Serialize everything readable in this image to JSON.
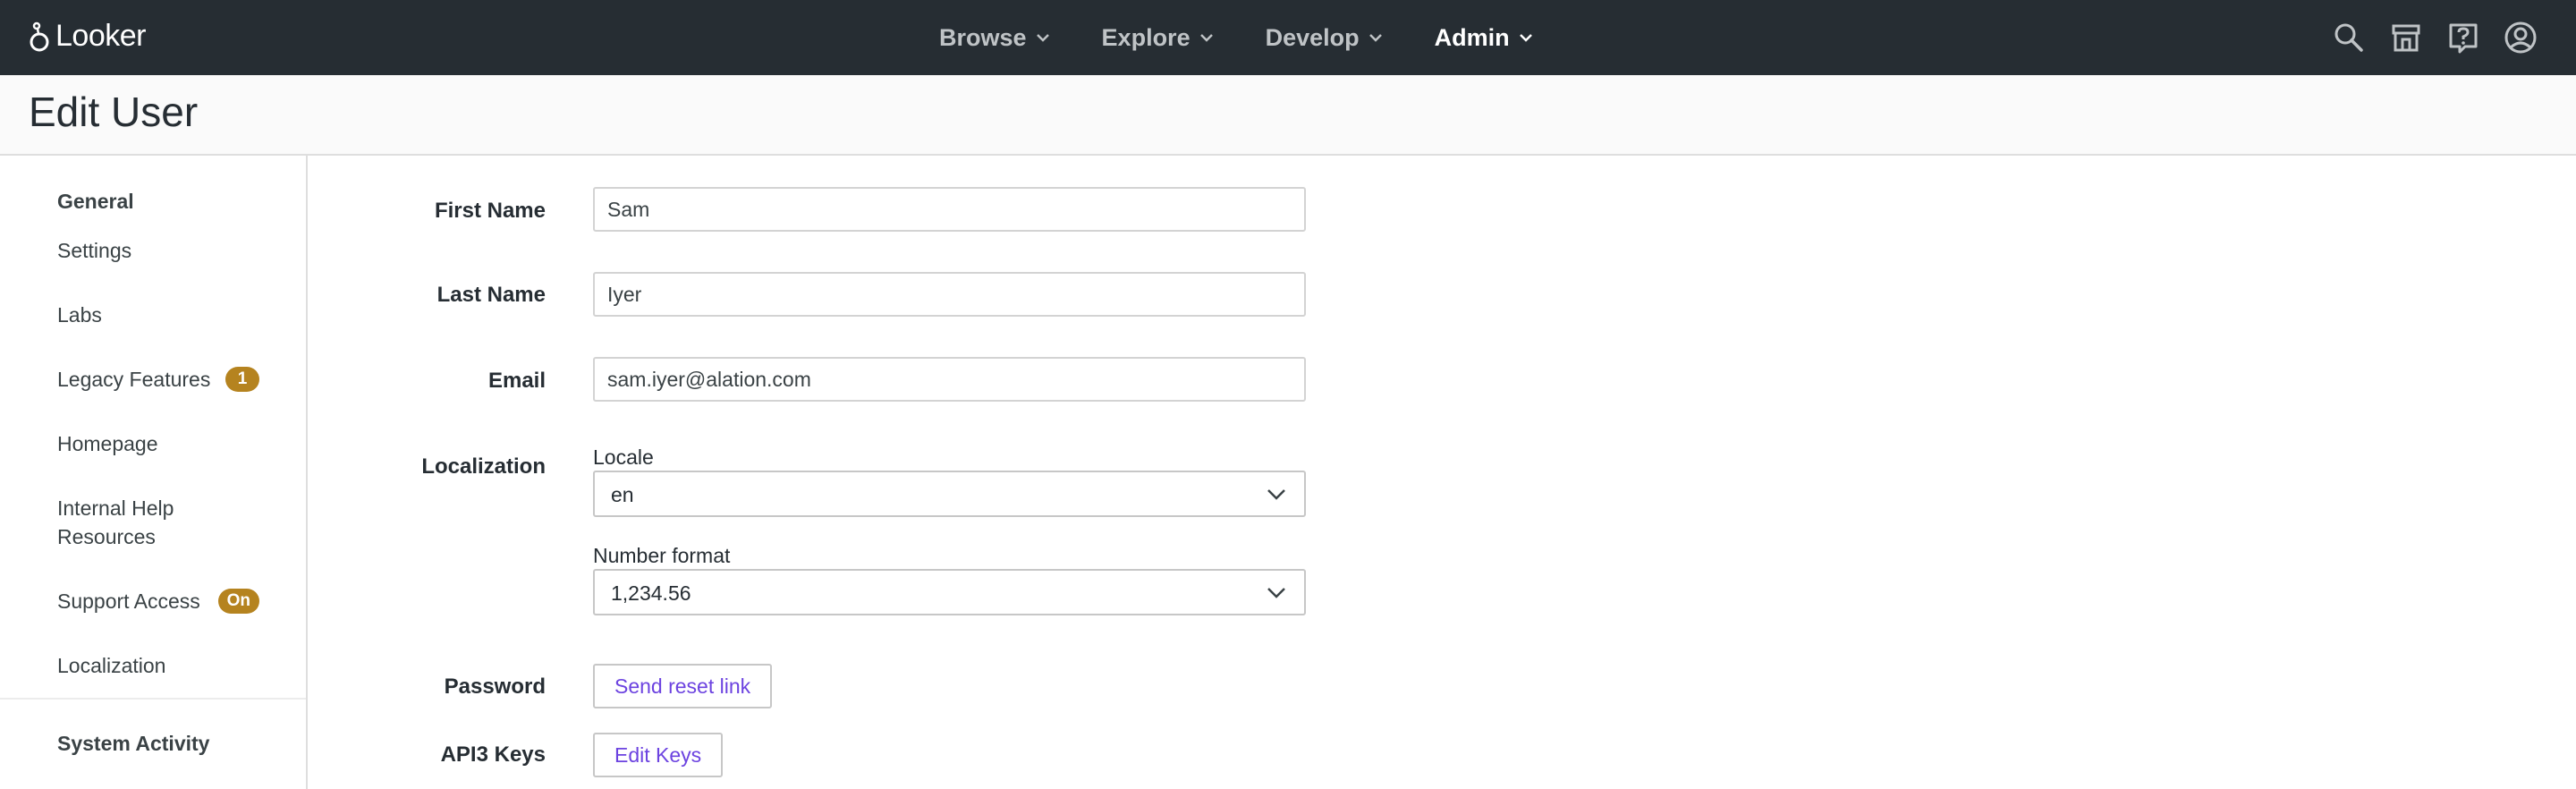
{
  "app": {
    "name": "Looker"
  },
  "nav": {
    "items": [
      {
        "label": "Browse",
        "active": false
      },
      {
        "label": "Explore",
        "active": false
      },
      {
        "label": "Develop",
        "active": false
      },
      {
        "label": "Admin",
        "active": true
      }
    ],
    "icons": [
      "search-icon",
      "marketplace-icon",
      "help-icon",
      "account-icon"
    ]
  },
  "page": {
    "title": "Edit User"
  },
  "sidebar": {
    "sections": [
      {
        "heading": "General",
        "items": [
          {
            "label": "Settings"
          },
          {
            "label": "Labs"
          },
          {
            "label": "Legacy Features",
            "badge": "1"
          },
          {
            "label": "Homepage"
          },
          {
            "label": "Internal Help Resources"
          },
          {
            "label": "Support Access",
            "badge": "On"
          },
          {
            "label": "Localization"
          }
        ]
      },
      {
        "heading": "System Activity",
        "items": []
      }
    ]
  },
  "form": {
    "first_name": {
      "label": "First Name",
      "value": "Sam"
    },
    "last_name": {
      "label": "Last Name",
      "value": "Iyer"
    },
    "email": {
      "label": "Email",
      "value": "sam.iyer@alation.com"
    },
    "localization": {
      "label": "Localization",
      "locale": {
        "label": "Locale",
        "value": "en"
      },
      "number_format": {
        "label": "Number format",
        "value": "1,234.56"
      }
    },
    "password": {
      "label": "Password",
      "button": "Send reset link"
    },
    "api3_keys": {
      "label": "API3 Keys",
      "button": "Edit Keys"
    }
  },
  "colors": {
    "nav_bg": "#262d33",
    "badge": "#b5831f",
    "link": "#6c43e0"
  }
}
